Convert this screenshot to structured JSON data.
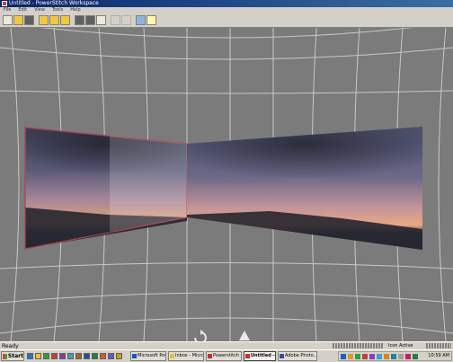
{
  "window": {
    "title": "Untitled - PowerStitch Workspace"
  },
  "menu": {
    "items": [
      "File",
      "Edit",
      "View",
      "Tools",
      "Help"
    ]
  },
  "toolbar": {
    "buttons": [
      {
        "name": "new-file-button",
        "icon": "new-file-icon"
      },
      {
        "name": "open-button",
        "icon": "open-folder-icon"
      },
      {
        "name": "save-button",
        "icon": "save-icon"
      },
      {
        "name": "add-image-button",
        "icon": "add-image-icon"
      },
      {
        "name": "add-folder-button",
        "icon": "folder-icon"
      },
      {
        "name": "layers-button",
        "icon": "layers-icon"
      },
      {
        "name": "grid-view-button",
        "icon": "grid-icon"
      },
      {
        "name": "render-button",
        "icon": "render-icon"
      },
      {
        "name": "window-button",
        "icon": "window-icon"
      },
      {
        "name": "disabled-button-1",
        "icon": "disabled-icon"
      },
      {
        "name": "disabled-button-2",
        "icon": "disabled-icon"
      },
      {
        "name": "preview-button",
        "icon": "preview-icon"
      },
      {
        "name": "help-button",
        "icon": "help-question-icon"
      }
    ]
  },
  "workspace": {
    "background": "#7b7b7b",
    "grid_color": "#c8c8c8",
    "panel_border": "#b04050",
    "controls": {
      "rotate_icon": "rotate-icon",
      "warp_icon": "warp-tool-icon"
    }
  },
  "status": {
    "ready": "Ready",
    "mode": "Icon Active"
  },
  "taskbar": {
    "start": "Start",
    "tasks": [
      {
        "label": "Microsoft Pow...",
        "icon_color": "#2050c0"
      },
      {
        "label": "Inbox - Micros...",
        "icon_color": "#e0c040"
      },
      {
        "label": "Powerstitch ...",
        "icon_color": "#c03030"
      },
      {
        "label": "Untitled - ...",
        "icon_color": "#c03030"
      },
      {
        "label": "Adobe Photo...",
        "icon_color": "#3050a0"
      }
    ],
    "clock": "10:59 AM"
  }
}
